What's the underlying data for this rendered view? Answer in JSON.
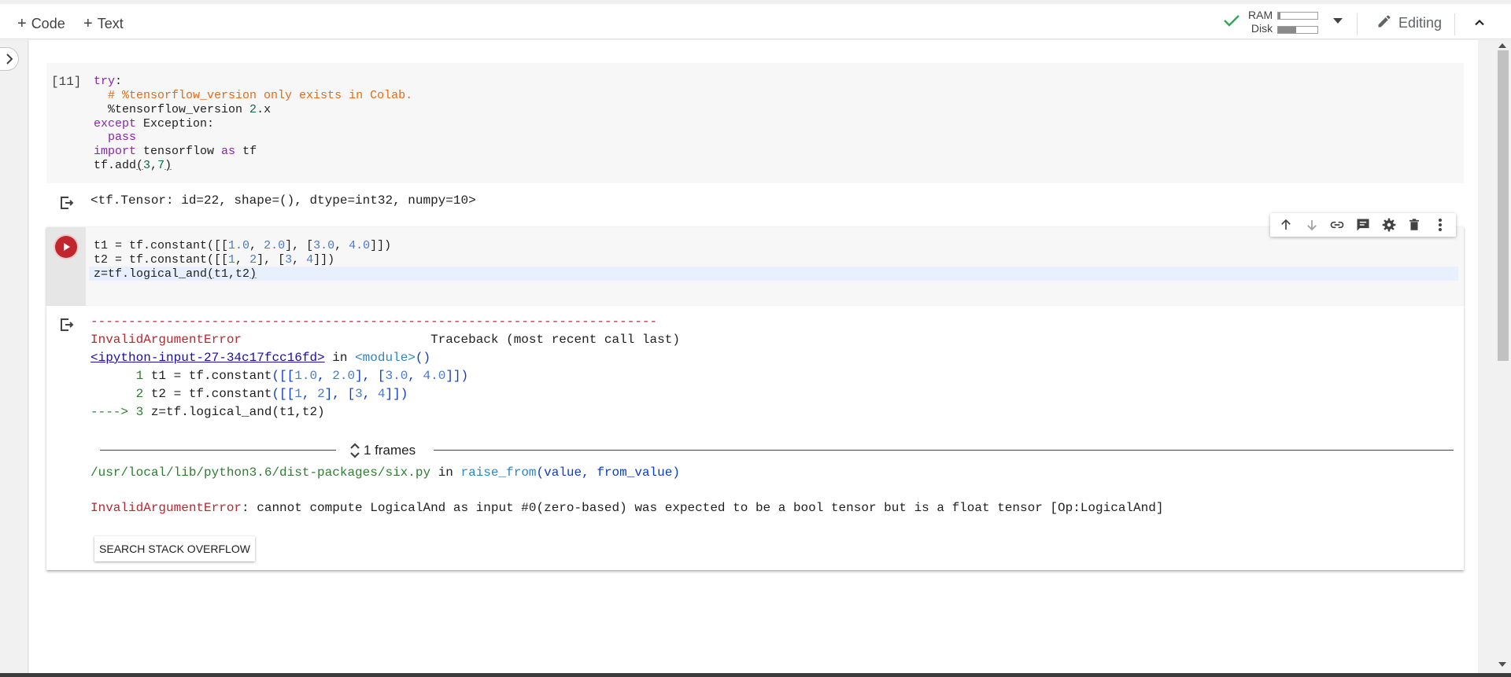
{
  "toolbar": {
    "add_code_label": "Code",
    "add_text_label": "Text",
    "ram_label": "RAM",
    "disk_label": "Disk",
    "ram_usage": 0.05,
    "disk_usage": 0.45,
    "editing_label": "Editing"
  },
  "cells": [
    {
      "execution_count": "[11]",
      "code_lines": [
        "try:",
        "  # %tensorflow_version only exists in Colab.",
        "  %tensorflow_version 2.x",
        "except Exception:",
        "  pass",
        "import tensorflow as tf",
        "tf.add(3,7)"
      ],
      "output": "<tf.Tensor: id=22, shape=(), dtype=int32, numpy=10>"
    },
    {
      "code_lines": [
        "t1 = tf.constant([[1.0, 2.0], [3.0, 4.0]])",
        "t2 = tf.constant([[1, 2], [3, 4]])",
        "z=tf.logical_and(t1,t2)"
      ],
      "error": {
        "separator": "---------------------------------------------------------------------------",
        "name": "InvalidArgumentError",
        "traceback_header": "Traceback (most recent call last)",
        "input_link": "<ipython-input-27-34c17fcc16fd>",
        "in_word": "in",
        "module": "<module>",
        "module_call": "()",
        "frame_lines": [
          {
            "marker": "      1 ",
            "code": "t1 = tf.constant([[1.0, 2.0], [3.0, 4.0]])"
          },
          {
            "marker": "      2 ",
            "code": "t2 = tf.constant([[1, 2], [3, 4]])"
          },
          {
            "marker": "----> 3 ",
            "code": "z=tf.logical_and(t1,t2)"
          }
        ],
        "frames_label": "1 frames",
        "lib_path": "/usr/local/lib/python3.6/dist-packages/six.py",
        "lib_func": "raise_from",
        "lib_args": "(value, from_value)",
        "message": ": cannot compute LogicalAnd as input #0(zero-based) was expected to be a bool tensor but is a float tensor [Op:LogicalAnd]",
        "search_button": "SEARCH STACK OVERFLOW"
      }
    }
  ],
  "colors": {
    "run_button": "#c0262d",
    "error_red": "#b22b31",
    "keyword": "#8e24aa",
    "comment": "#e06c1a"
  }
}
